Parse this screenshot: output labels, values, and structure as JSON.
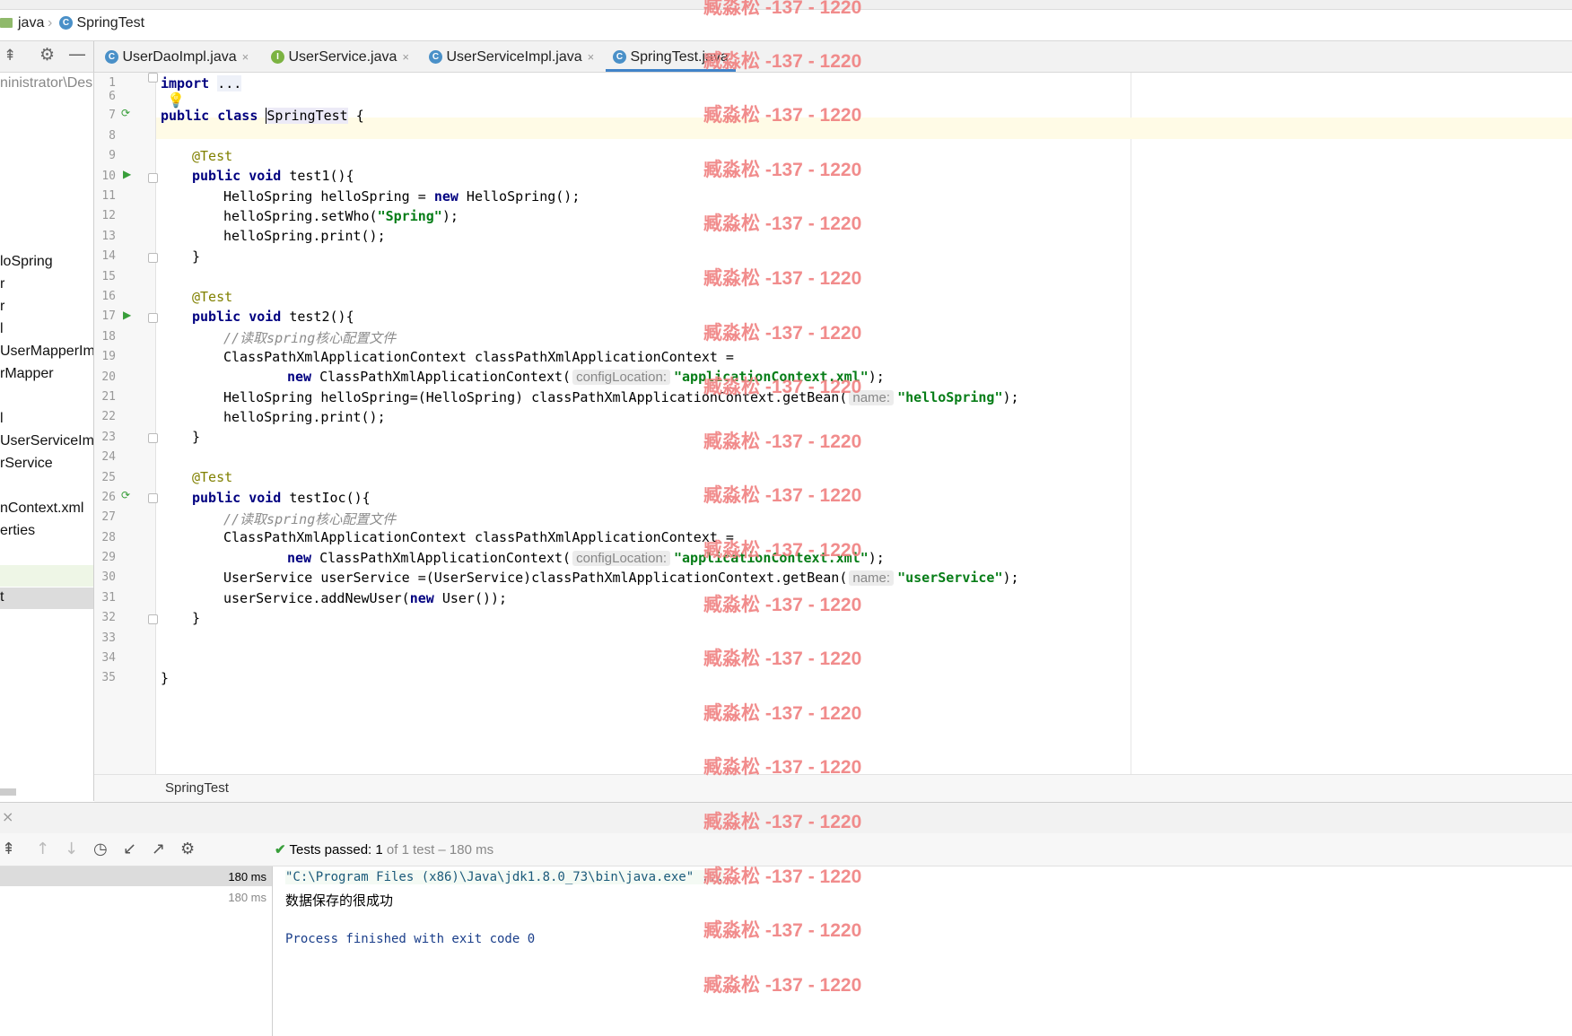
{
  "breadcrumb": {
    "items": [
      "java",
      "SpringTest"
    ]
  },
  "project_panel": {
    "path_fragment": "ninistrator\\Des",
    "items": [
      "loSpring",
      "r",
      "r",
      "l",
      "UserMapperIm",
      "rMapper",
      "l",
      "UserServiceIm",
      "rService",
      "nContext.xml",
      "erties",
      "t"
    ]
  },
  "tabs": [
    {
      "label": "UserDaoImpl.java",
      "icon": "C",
      "active": false
    },
    {
      "label": "UserService.java",
      "icon": "I",
      "active": false
    },
    {
      "label": "UserServiceImpl.java",
      "icon": "C",
      "active": false
    },
    {
      "label": "SpringTest.java",
      "icon": "C",
      "active": true
    }
  ],
  "close_glyph": "×",
  "editor": {
    "line_numbers": [
      "1",
      "6",
      "7",
      "8",
      "9",
      "10",
      "11",
      "12",
      "13",
      "14",
      "15",
      "16",
      "17",
      "18",
      "19",
      "20",
      "21",
      "22",
      "23",
      "24",
      "25",
      "26",
      "27",
      "28",
      "29",
      "30",
      "31",
      "32",
      "33",
      "34",
      "35"
    ],
    "tokens": {
      "import": "import",
      "dots": "...",
      "public": "public",
      "class": "class",
      "classname": "SpringTest",
      "brace_open": " {",
      "ann_test": "@Test",
      "void": "void",
      "test1_sig": " test1(){",
      "l11_a": "HelloSpring helloSpring = ",
      "new": "new",
      "l11_b": " HelloSpring();",
      "l12_a": "helloSpring.setWho(",
      "l12_str": "\"Spring\"",
      "l12_b": ");",
      "l13": "helloSpring.print();",
      "close": "}",
      "test2_sig": " test2(){",
      "comment": "//读取spring核心配置文件",
      "l19": "ClassPathXmlApplicationContext classPathXmlApplicationContext =",
      "l20_a": " ClassPathXmlApplicationContext(",
      "hint_config": "configLocation:",
      "l20_str": "\"applicationContext.xml\"",
      "l20_b": ");",
      "l21_a": "HelloSpring helloSpring=(HelloSpring) classPathXmlApplicationContext.getBean(",
      "hint_name": "name:",
      "l21_str": "\"helloSpring\"",
      "l21_b": ");",
      "l22": "helloSpring.print();",
      "testioc_sig": " testIoc(){",
      "l30_a": "UserService userService =(UserService)classPathXmlApplicationContext.getBean(",
      "l30_str": "\"userService\"",
      "l30_b": ");",
      "l31_a": "userService.addNewUser(",
      "l31_b": " User());"
    },
    "footer_class": "SpringTest"
  },
  "run": {
    "status_prefix": "Tests passed:",
    "status_count": "1",
    "status_rest": "of 1 test – 180 ms",
    "tree_times": [
      "180 ms",
      "180 ms"
    ],
    "console": [
      "\"C:\\Program Files (x86)\\Java\\jdk1.8.0_73\\bin\\java.exe\" ...",
      "数据保存的很成功",
      "Process finished with exit code 0"
    ]
  },
  "watermark": "臧淼松 -137 - 1220",
  "colors": {
    "keyword": "#000080",
    "string": "#067d17",
    "annotation": "#808000",
    "comment": "#8c8c8c",
    "tab_underline": "#4083c9",
    "watermark": "#f08080"
  }
}
